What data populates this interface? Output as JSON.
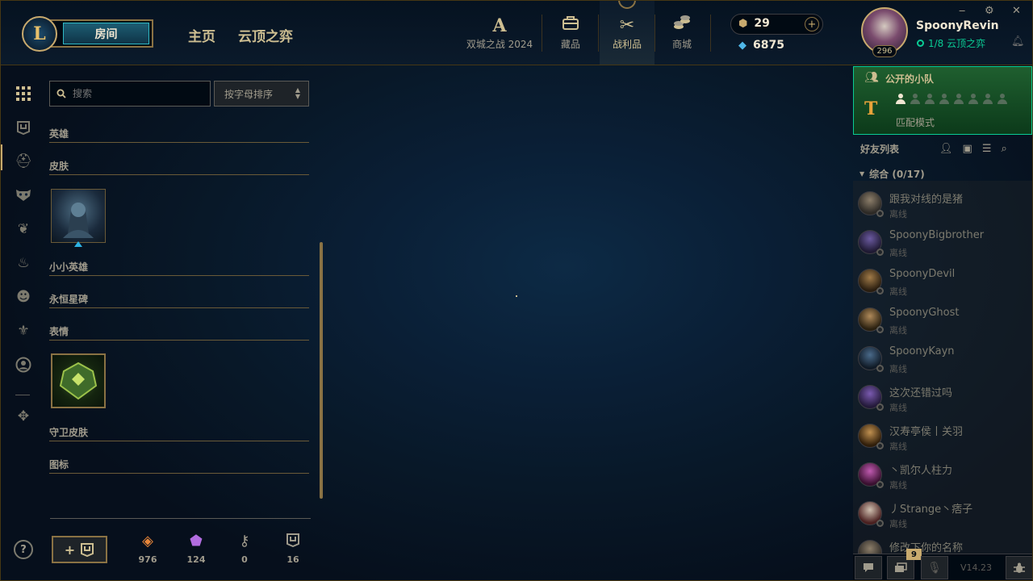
{
  "topbar": {
    "logo_text": "L",
    "play_label": "房间",
    "nav_home": "主页",
    "nav_tft": "云顶之弈",
    "tabs": [
      {
        "label": "双城之战 2024",
        "icon": "arcane-icon"
      },
      {
        "label": "藏品",
        "icon": "collection-icon"
      },
      {
        "label": "战利品",
        "icon": "loot-icon"
      },
      {
        "label": "商城",
        "icon": "store-icon"
      }
    ],
    "rp_amount": "29",
    "be_amount": "6875",
    "plus_label": "+"
  },
  "profile": {
    "username": "SpoonyRevin",
    "level": "296",
    "status": "1/8 云顶之弈"
  },
  "window": {
    "minimize": "‒",
    "settings": "⚙",
    "close": "✕"
  },
  "collection": {
    "search_placeholder": "搜索",
    "sort_label": "按字母排序",
    "categories": [
      "英雄",
      "皮肤",
      "小小英雄",
      "永恒星碑",
      "表情",
      "守卫皮肤",
      "图标"
    ],
    "stats": [
      {
        "value": "976",
        "icon": "orange-essence-icon",
        "color": "#e8863a"
      },
      {
        "value": "124",
        "icon": "mythic-essence-icon",
        "color": "#b26de0"
      },
      {
        "value": "0",
        "icon": "key-icon",
        "color": "#a09b8c"
      },
      {
        "value": "16",
        "icon": "chest-icon",
        "color": "#a09b8c"
      }
    ],
    "help_label": "?"
  },
  "party": {
    "title": "公开的小队",
    "mode": "匹配模式",
    "slots_filled": 1,
    "slots_total": 8
  },
  "friends": {
    "header": "好友列表",
    "group_label": "综合 (0/17)",
    "items": [
      {
        "name": "跟我对线的是猪",
        "status": "离线"
      },
      {
        "name": "SpoonyBigbrother",
        "status": "离线"
      },
      {
        "name": "SpoonyDevil",
        "status": "离线"
      },
      {
        "name": "SpoonyGhost",
        "status": "离线"
      },
      {
        "name": "SpoonyKayn",
        "status": "离线"
      },
      {
        "name": "这次还错过吗",
        "status": "离线"
      },
      {
        "name": "汉寿亭侯丨关羽",
        "status": "离线"
      },
      {
        "name": "丶凯尔人柱力",
        "status": "离线"
      },
      {
        "name": "丿Strange丶痞子",
        "status": "离线"
      },
      {
        "name": "修改下你的名称",
        "status": ""
      }
    ]
  },
  "footer": {
    "notification_count": "9",
    "version": "V14.23"
  },
  "colors": {
    "gold": "#c8aa6e",
    "teal": "#0acb94",
    "bg": "#010a13"
  }
}
